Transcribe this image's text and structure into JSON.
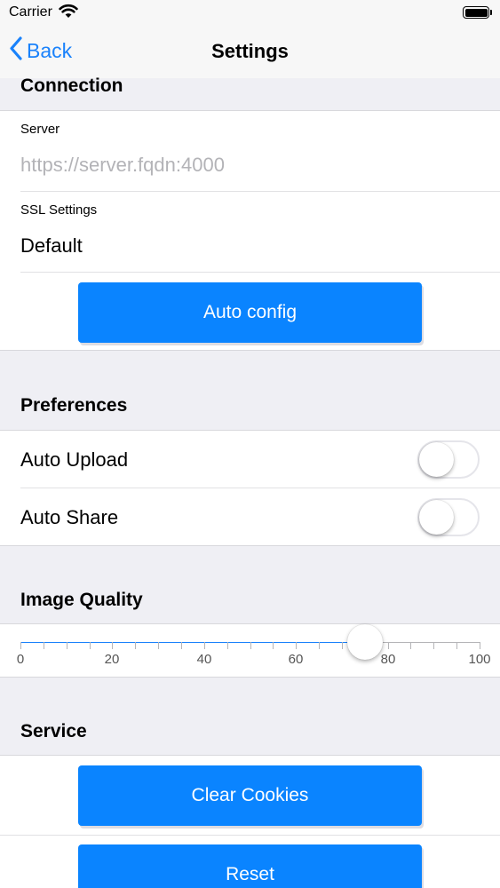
{
  "status_bar": {
    "carrier": "Carrier"
  },
  "nav": {
    "back_label": "Back",
    "title": "Settings"
  },
  "connection": {
    "header": "Connection",
    "server_label": "Server",
    "server_placeholder": "https://server.fqdn:4000",
    "ssl_label": "SSL Settings",
    "ssl_value": "Default",
    "auto_config_label": "Auto config"
  },
  "preferences": {
    "header": "Preferences",
    "auto_upload_label": "Auto Upload",
    "auto_upload_on": false,
    "auto_share_label": "Auto Share",
    "auto_share_on": false
  },
  "image_quality": {
    "header": "Image Quality",
    "value": 75,
    "min": 0,
    "max": 100,
    "tick_labels": [
      "0",
      "20",
      "40",
      "60",
      "80",
      "100"
    ]
  },
  "service": {
    "header": "Service",
    "clear_cookies_label": "Clear Cookies",
    "reset_label": "Reset"
  },
  "colors": {
    "accent": "#0a84ff",
    "background": "#efeff4"
  }
}
